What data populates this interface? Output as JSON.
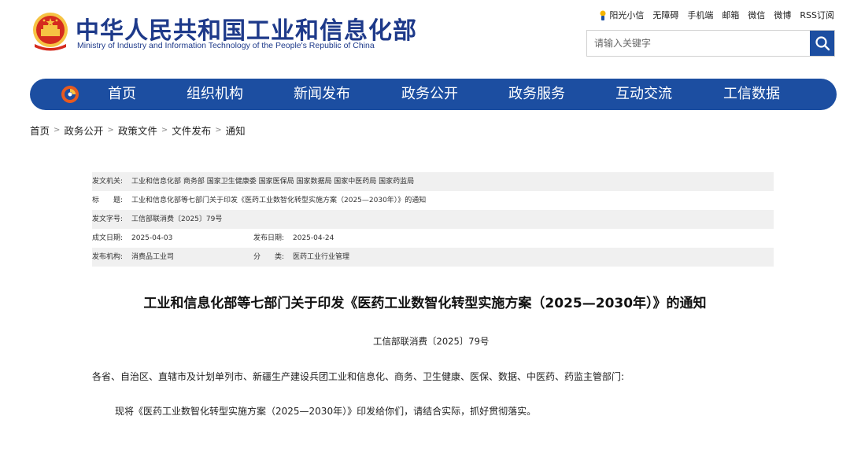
{
  "header": {
    "title": "中华人民共和国工业和信息化部",
    "subtitle": "Ministry of Industry and Information Technology of the People's Republic of China",
    "emblem_icon": "national-emblem-icon"
  },
  "toplinks": [
    "阳光小信",
    "无障碍",
    "手机端",
    "邮箱",
    "微信",
    "微博",
    "RSS订阅"
  ],
  "search": {
    "placeholder": "请输入关键字",
    "icon": "search-icon"
  },
  "nav": {
    "logo_icon": "ministry-logo-icon",
    "items": [
      "首页",
      "组织机构",
      "新闻发布",
      "政务公开",
      "政务服务",
      "互动交流",
      "工信数据"
    ]
  },
  "breadcrumb": [
    "首页",
    "政务公开",
    "政策文件",
    "文件发布",
    "通知"
  ],
  "breadcrumb_separator": ">",
  "meta": {
    "issuer_label": "发文机关:",
    "issuer_value": "工业和信息化部 商务部 国家卫生健康委 国家医保局 国家数据局 国家中医药局 国家药监局",
    "title_label": "标　　题:",
    "title_value": "工业和信息化部等七部门关于印发《医药工业数智化转型实施方案（2025—2030年）》的通知",
    "docno_label": "发文字号:",
    "docno_value": "工信部联消费〔2025〕79号",
    "created_label": "成文日期:",
    "created_value": "2025-04-03",
    "published_label": "发布日期:",
    "published_value": "2025-04-24",
    "org_label": "发布机构:",
    "org_value": "消费品工业司",
    "category_label": "分　　类:",
    "category_value": "医药工业行业管理"
  },
  "article": {
    "title": "工业和信息化部等七部门关于印发《医药工业数智化转型实施方案（2025—2030年）》的通知",
    "doc_number": "工信部联消费〔2025〕79号",
    "paragraph1": "各省、自治区、直辖市及计划单列市、新疆生产建设兵团工业和信息化、商务、卫生健康、医保、数据、中医药、药监主管部门:",
    "paragraph2": "现将《医药工业数智化转型实施方案（2025—2030年）》印发给你们，请结合实际，抓好贯彻落实。"
  },
  "colors": {
    "brand_blue": "#1c4ea1",
    "title_blue": "#1e3a8a",
    "emblem_red": "#d52b1e",
    "emblem_gold": "#f6c343",
    "row_shade": "#f0f0f0"
  }
}
